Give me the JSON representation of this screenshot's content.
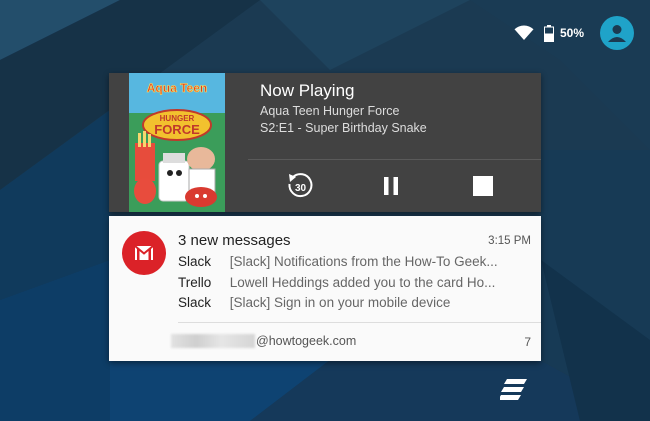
{
  "status_bar": {
    "battery_percent": "50%",
    "icons": [
      "wifi-icon",
      "battery-icon",
      "account-icon"
    ]
  },
  "media": {
    "title": "Now Playing",
    "artist": "Aqua Teen Hunger Force",
    "episode": "S2:E1 - Super Birthday Snake",
    "art_text": [
      "Aqua Teen",
      "HUNGER",
      "FORCE"
    ],
    "controls": [
      "replay-30-icon",
      "pause-icon",
      "stop-icon"
    ],
    "replay_seconds": "30"
  },
  "notification": {
    "title": "3 new messages",
    "time": "3:15 PM",
    "messages": [
      {
        "sender": "Slack",
        "text": "[Slack] Notifications from the How-To Geek..."
      },
      {
        "sender": "Trello",
        "text": "Lowell Heddings added you to the card Ho..."
      },
      {
        "sender": "Slack",
        "text": "[Slack] Sign in on your mobile device"
      }
    ],
    "account": "@howtogeek.com",
    "count": "7",
    "icon": "gmail-icon"
  },
  "colors": {
    "accent_avatar": "#1fa3c9",
    "gmail_red": "#db2228",
    "media_bg": "#424242"
  }
}
